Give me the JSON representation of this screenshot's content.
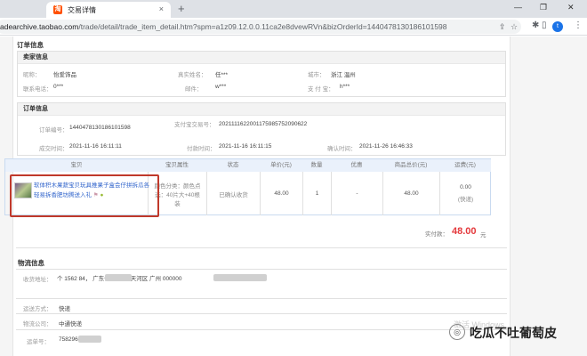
{
  "browser": {
    "tab_title": "交易详情",
    "tab_close": "×",
    "new_tab": "+",
    "url_prefix": "adearchive.taobao.com",
    "url_rest": "/trade/detail/trade_item_detail.htm?spm=a1z09.12.0.0.11ca2e8dvewRVn&bizOrderId=1440478130186101598",
    "avatar": "t",
    "win_min": "—",
    "win_max": "❐",
    "win_close": "✕"
  },
  "order_info_title": "订单信息",
  "seller": {
    "heading": "卖家信息",
    "fields": [
      {
        "label": "昵称：",
        "value": "怡爱饰品"
      },
      {
        "label": "真实姓名：",
        "value": "任***"
      },
      {
        "label": "城市：",
        "value": "浙江 温州"
      },
      {
        "label": "联系电话：",
        "value": "0***"
      },
      {
        "label": "邮件：",
        "value": "w***"
      },
      {
        "label": "支 付 宝：",
        "value": "h***"
      }
    ]
  },
  "order": {
    "heading": "订单信息",
    "fields": [
      {
        "label": "订单编号：",
        "value": "1440478130186101598"
      },
      {
        "label": "支付宝交易号：",
        "value": "2021111622001175985752090622"
      },
      {
        "label": "成交时间：",
        "value": "2021-11-16 16:11:11"
      },
      {
        "label": "付款时间：",
        "value": "2021-11-16 16:11:15"
      },
      {
        "label": "确认时间：",
        "value": "2021-11-26 16:46:33"
      }
    ]
  },
  "table": {
    "headers": [
      "宝贝",
      "宝贝属性",
      "状态",
      "单价(元)",
      "数量",
      "优惠",
      "商品总价(元)",
      "运费(元)"
    ],
    "row": {
      "product": "软体积木果蔬宝贝玩具推果子盒会仔拼拆瓜各轻易拆香肥坊腾送入礼",
      "attr": "颜色分类：颜色点选：40片大+40根装",
      "status": "已确认收货",
      "price": "48.00",
      "qty": "1",
      "discount": "-",
      "total": "48.00",
      "shipping": "0.00",
      "shipping_note": "(快递)"
    }
  },
  "summary": {
    "label": "实付款：",
    "value": "48.00",
    "unit": "元"
  },
  "logistics": {
    "title": "物流信息",
    "fields": [
      {
        "label": "收货地址：",
        "value": "个    1562        84， 广东省 广州市 天河区 广州      000000"
      },
      {
        "label": "运送方式：",
        "value": "快递"
      },
      {
        "label": "物流公司：",
        "value": "中通快递"
      },
      {
        "label": "运单号：",
        "value": "758296       523"
      }
    ]
  },
  "watermark": "激活 Windows",
  "brand": "吃瓜不吐葡萄皮"
}
